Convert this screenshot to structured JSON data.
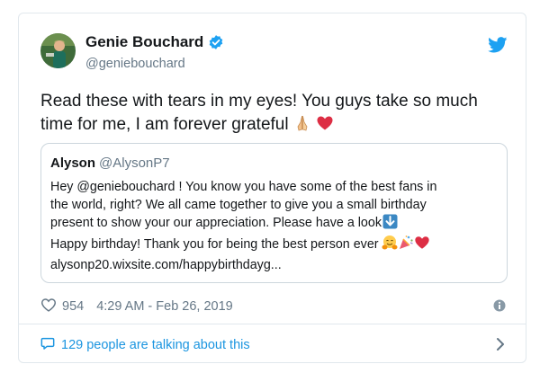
{
  "author": {
    "name": "Genie Bouchard",
    "handle": "@geniebouchard",
    "verified": true
  },
  "tweet": {
    "text": "Read these with tears in my eyes! You guys take so much time for me, I am forever grateful",
    "emojis": [
      "folded-hands",
      "red-heart"
    ]
  },
  "quoted_tweet": {
    "name": "Alyson",
    "handle": "@AlysonP7",
    "lines": [
      "Hey @geniebouchard ! You know you have some of the best fans in",
      "the world, right? We all came together to give you a small birthday",
      "present to show your our appreciation. Please have a look",
      "Happy birthday! Thank you for being the best person ever",
      "alysonp20.wixsite.com/happybirthdayg..."
    ]
  },
  "meta": {
    "likes": "954",
    "time": "4:29 AM - Feb 26, 2019"
  },
  "footer": {
    "talking": "129 people are talking about this"
  },
  "colors": {
    "twitter_blue": "#1da1f2",
    "link_blue": "#1b95e0",
    "gray": "#657786",
    "border": "#e1e8ed"
  }
}
